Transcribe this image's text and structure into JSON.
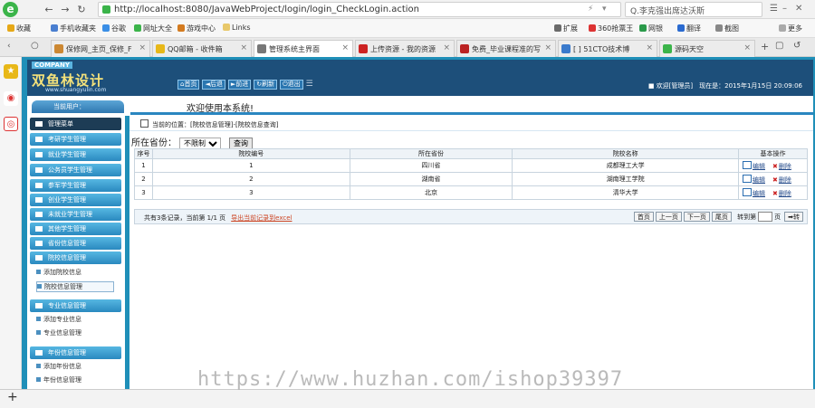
{
  "browser": {
    "url": "http://localhost:8080/JavaWebProject/login/login_CheckLogin.action",
    "search_text": "Q.李克强出席达沃斯",
    "nav": {
      "back": "←",
      "forward": "→",
      "refresh": "↻",
      "home": "⌂"
    },
    "bookmarks": [
      "收藏",
      "手机收藏夹",
      "谷歌",
      "网址大全",
      "游戏中心",
      "Links",
      "扩展",
      "360抢票王",
      "网银",
      "翻译",
      "截图",
      "更多"
    ],
    "tabs": [
      "保修网_主页_保修_F",
      "QQ邮箱 - 收件箱",
      "管理系统主界面",
      "上传资源 - 我的资源",
      "免费_毕业课程准的写",
      "[ ] 51CTO技术博",
      "源码天空"
    ]
  },
  "app": {
    "company": "COMPANY",
    "brand": "双鱼林设计",
    "brand_sub": "www.shuangyulin.com",
    "toolbar": [
      "首页",
      "后退",
      "前进",
      "刷新",
      "退出"
    ],
    "welcome": "欢迎[管理员]　现在是：2015年1月15日 20:09:06",
    "current_user": "当前用户：",
    "welcome_msg": "欢迎使用本系统!",
    "menu_title": "管理菜单",
    "menu": [
      "考研学生管理",
      "就业学生管理",
      "公务员学生管理",
      "参军学生管理",
      "创业学生管理",
      "未就业学生管理",
      "其他学生管理",
      "省份信息管理",
      "院校信息管理"
    ],
    "school_items": [
      "添加院校信息",
      "院校信息管理"
    ],
    "major_header": "专业信息管理",
    "major_items": [
      "添加专业信息",
      "专业信息管理"
    ],
    "year_header": "年份信息管理",
    "year_items": [
      "添加年份信息",
      "年份信息管理"
    ]
  },
  "main": {
    "crumb": "当前的位置：[院校信息管理]-[院校信息查询]",
    "filter_label": "所在省份：",
    "filter_value": "不限制",
    "query_btn": "查询",
    "columns": [
      "序号",
      "院校编号",
      "所在省份",
      "院校名称",
      "基本操作"
    ],
    "rows": [
      [
        "1",
        "1",
        "四川省",
        "成都理工大学"
      ],
      [
        "2",
        "2",
        "湖南省",
        "湖南理工学院"
      ],
      [
        "3",
        "3",
        "北京",
        "清华大学"
      ]
    ],
    "edit_label": "编辑",
    "delete_label": "删除",
    "footer_info": "共有3条记录，当前第 1/1 页",
    "export_label": "导出当前记录到excel",
    "pager": [
      "首页",
      "上一页",
      "下一页",
      "尾页"
    ],
    "goto_label": "转到第",
    "page_unit": "页",
    "go_btn": "转"
  },
  "watermark": "https://www.huzhan.com/ishop39397"
}
